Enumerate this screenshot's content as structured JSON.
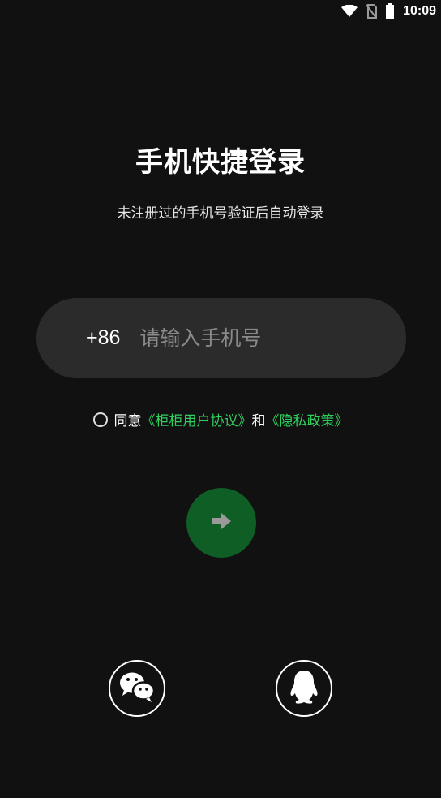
{
  "status_bar": {
    "time": "10:09",
    "icons": [
      "wifi-icon",
      "no-sim-icon",
      "battery-icon"
    ]
  },
  "login": {
    "title": "手机快捷登录",
    "subtitle": "未注册过的手机号验证后自动登录",
    "country_code": "+86",
    "phone_placeholder": "请输入手机号",
    "phone_value": ""
  },
  "agreement": {
    "checked": false,
    "prefix": "同意",
    "user_agreement_link": "《柜柜用户协议》",
    "conjunction": "和",
    "privacy_link": "《隐私政策》"
  },
  "submit": {
    "icon": "arrow-right-icon"
  },
  "social_login": {
    "options": [
      "wechat-icon",
      "qq-icon"
    ]
  },
  "colors": {
    "background": "#111111",
    "input_background": "#2b2b2b",
    "accent_green": "#2fd15e",
    "submit_disabled": "#0e5e26",
    "placeholder": "#8a8a8a"
  }
}
